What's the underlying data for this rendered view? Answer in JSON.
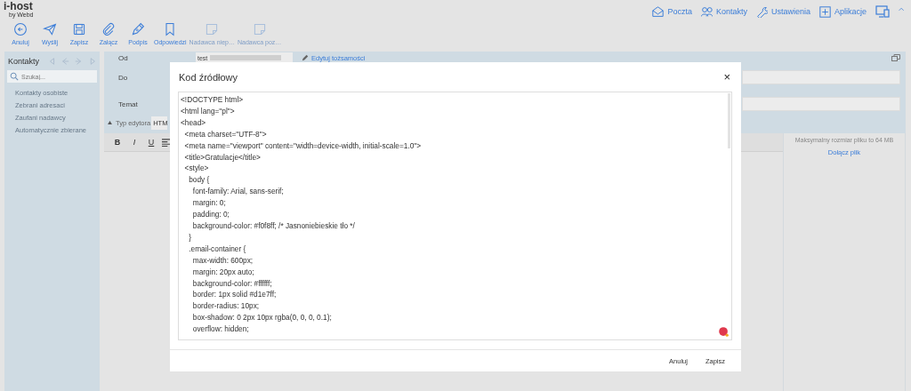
{
  "app": {
    "logo": "i-host",
    "logo_sub": "by Webd"
  },
  "nav": [
    {
      "kind": "mail",
      "label": "Poczta"
    },
    {
      "kind": "contacts",
      "label": "Kontakty"
    },
    {
      "kind": "wrench",
      "label": "Ustawienia"
    },
    {
      "kind": "plus",
      "label": "Aplikacje"
    },
    {
      "kind": "devices"
    },
    {
      "kind": "caret"
    }
  ],
  "toolbar": [
    {
      "kind": "back",
      "label": "Anuluj",
      "disabled": false
    },
    {
      "kind": "send",
      "label": "Wyślij",
      "disabled": false
    },
    {
      "kind": "save",
      "label": "Zapisz",
      "disabled": false
    },
    {
      "kind": "clip",
      "label": "Załącz",
      "disabled": false
    },
    {
      "kind": "pen",
      "label": "Podpis",
      "disabled": false
    },
    {
      "kind": "bookmark",
      "label": "Odpowiedzi",
      "disabled": false
    },
    {
      "kind": "note",
      "label": "Nadawca niep…",
      "disabled": true
    },
    {
      "kind": "note",
      "label": "Nadawca poz…",
      "disabled": true
    }
  ],
  "sidebar": {
    "title": "Kontakty",
    "search": {
      "placeholder": "Szukaj..."
    },
    "items": [
      {
        "label": "Kontakty osobiste",
        "selected": false
      },
      {
        "label": "Zebrani adresaci",
        "selected": false
      },
      {
        "label": "Zaufani nadawcy",
        "selected": false
      },
      {
        "label": "Automatycznie zbierane",
        "selected": false
      }
    ]
  },
  "compose": {
    "from_label": "Od",
    "from_value": "test",
    "edit_identity": "Edytuj tożsamości",
    "to_label": "Do",
    "subject_label": "Temat",
    "editor_type_label": "Typ edytora",
    "editor_type_value": "HTM",
    "format_buttons": [
      "B",
      "I",
      "U"
    ]
  },
  "attachments": {
    "limit": "Maksymalny rozmiar pliku to 64 MB",
    "attach": "Dołącz plik"
  },
  "dialog": {
    "title": "Kod źródłowy",
    "close": "×",
    "code": "<!DOCTYPE html>\n<html lang=\"pl\">\n<head>\n  <meta charset=\"UTF-8\">\n  <meta name=\"viewport\" content=\"width=device-width, initial-scale=1.0\">\n  <title>Gratulacje</title>\n  <style>\n    body {\n      font-family: Arial, sans-serif;\n      margin: 0;\n      padding: 0;\n      background-color: #f0f8ff; /* Jasnoniebieskie tło */\n    }\n    .email-container {\n      max-width: 600px;\n      margin: 20px auto;\n      background-color: #ffffff;\n      border: 1px solid #d1e7ff;\n      border-radius: 10px;\n      box-shadow: 0 2px 10px rgba(0, 0, 0, 0.1);\n      overflow: hidden;",
    "buttons": [
      "Anuluj",
      "Zapisz"
    ]
  }
}
